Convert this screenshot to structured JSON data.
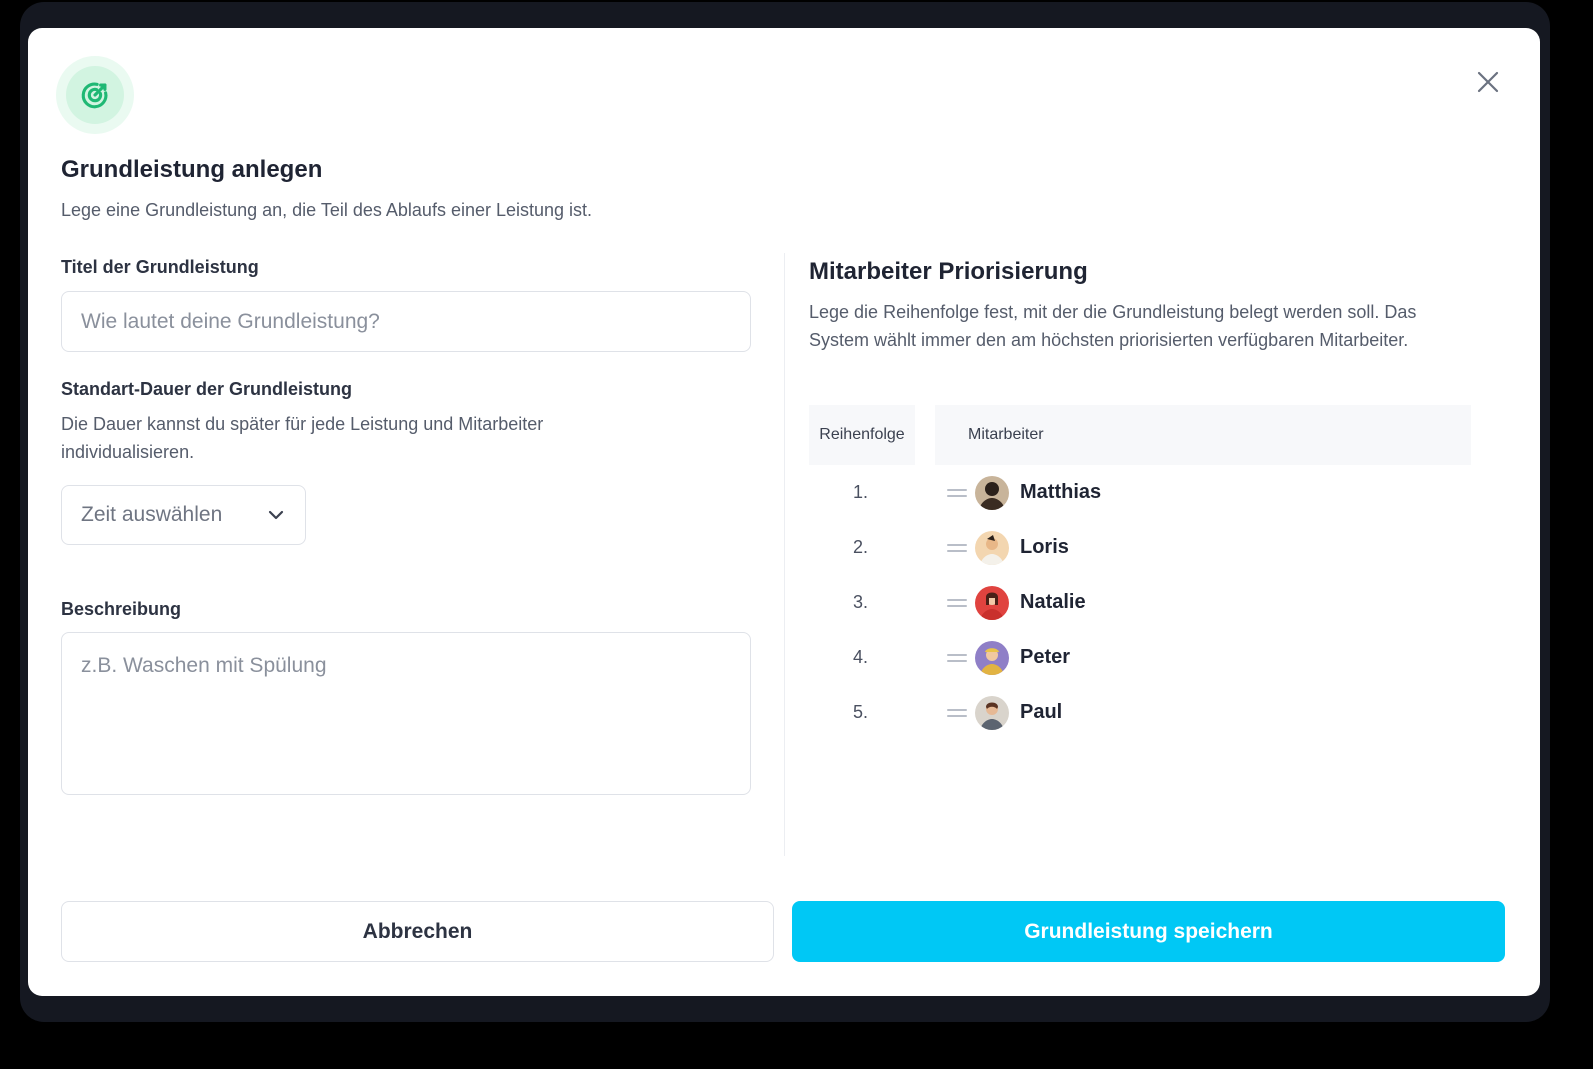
{
  "modal": {
    "title": "Grundleistung anlegen",
    "subtitle": "Lege eine Grundleistung an, die Teil des Ablaufs einer Leistung ist.",
    "icon": "target-icon",
    "accent_color": "#00c8f5",
    "icon_color": "#1fb874"
  },
  "form": {
    "title_label": "Titel der Grundleistung",
    "title_placeholder": "Wie lautet deine Grundleistung?",
    "duration_label": "Standart-Dauer der Grundleistung",
    "duration_help": "Die Dauer kannst du später für jede Leistung und Mitarbeiter individualisieren.",
    "duration_select": "Zeit auswählen",
    "description_label": "Beschreibung",
    "description_placeholder": "z.B. Waschen mit Spülung"
  },
  "priority": {
    "title": "Mitarbeiter Priorisierung",
    "description": "Lege die Reihenfolge fest, mit der die Grundleistung belegt werden soll. Das System wählt immer den am höchsten priorisierten verfügbaren Mitarbeiter.",
    "col_order": "Reihenfolge",
    "col_employee": "Mitarbeiter",
    "rows": [
      {
        "rank": "1.",
        "name": "Matthias",
        "avatar_bg": "#c8b49a"
      },
      {
        "rank": "2.",
        "name": "Loris",
        "avatar_bg": "#f3d6b0"
      },
      {
        "rank": "3.",
        "name": "Natalie",
        "avatar_bg": "#e0433f"
      },
      {
        "rank": "4.",
        "name": "Peter",
        "avatar_bg": "#8f7fc7"
      },
      {
        "rank": "5.",
        "name": "Paul",
        "avatar_bg": "#d9d4cc"
      }
    ]
  },
  "footer": {
    "cancel_label": "Abbrechen",
    "save_label": "Grundleistung speichern"
  }
}
